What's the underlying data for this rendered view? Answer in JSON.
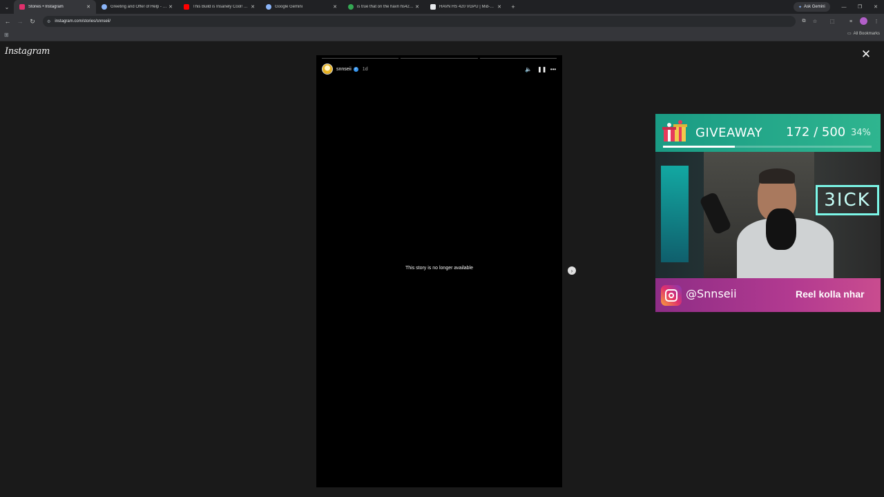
{
  "browser": {
    "tabs": [
      {
        "title": "Stories • Instagram",
        "favicon_color": "#e1306c",
        "active": true
      },
      {
        "title": "Greeting and Offer of Help - Ge",
        "favicon_color": "#8ab4f8",
        "active": false
      },
      {
        "title": "This Build is Insanely Cool! HAV",
        "favicon_color": "#ff0000",
        "active": false
      },
      {
        "title": "Google Gemini",
        "favicon_color": "#8ab4f8",
        "active": false
      },
      {
        "title": "is true that on the havn hs420 u",
        "favicon_color": "#34a853",
        "active": false
      },
      {
        "title": "HAVN HS 420 VGPU | Mid-Tow",
        "favicon_color": "#e8eaed",
        "active": false
      }
    ],
    "ask_gemini": "Ask Gemini",
    "url": "instagram.com/stories/snnseii/",
    "all_bookmarks": "All Bookmarks"
  },
  "instagram": {
    "logo": "Instagram",
    "story": {
      "username": "snnseii",
      "time": "1d",
      "message": "This story is no longer available"
    }
  },
  "giveaway": {
    "title": "GIVEAWAY",
    "count": "172 / 500",
    "percent": "34%",
    "progress": 0.344,
    "handle": "@Snnseii",
    "cta": "Reel kolla nhar",
    "neon_text": "3ICK"
  },
  "colors": {
    "giveaway_green": "#1a9b84",
    "giveaway_pink": "#b23a90"
  }
}
